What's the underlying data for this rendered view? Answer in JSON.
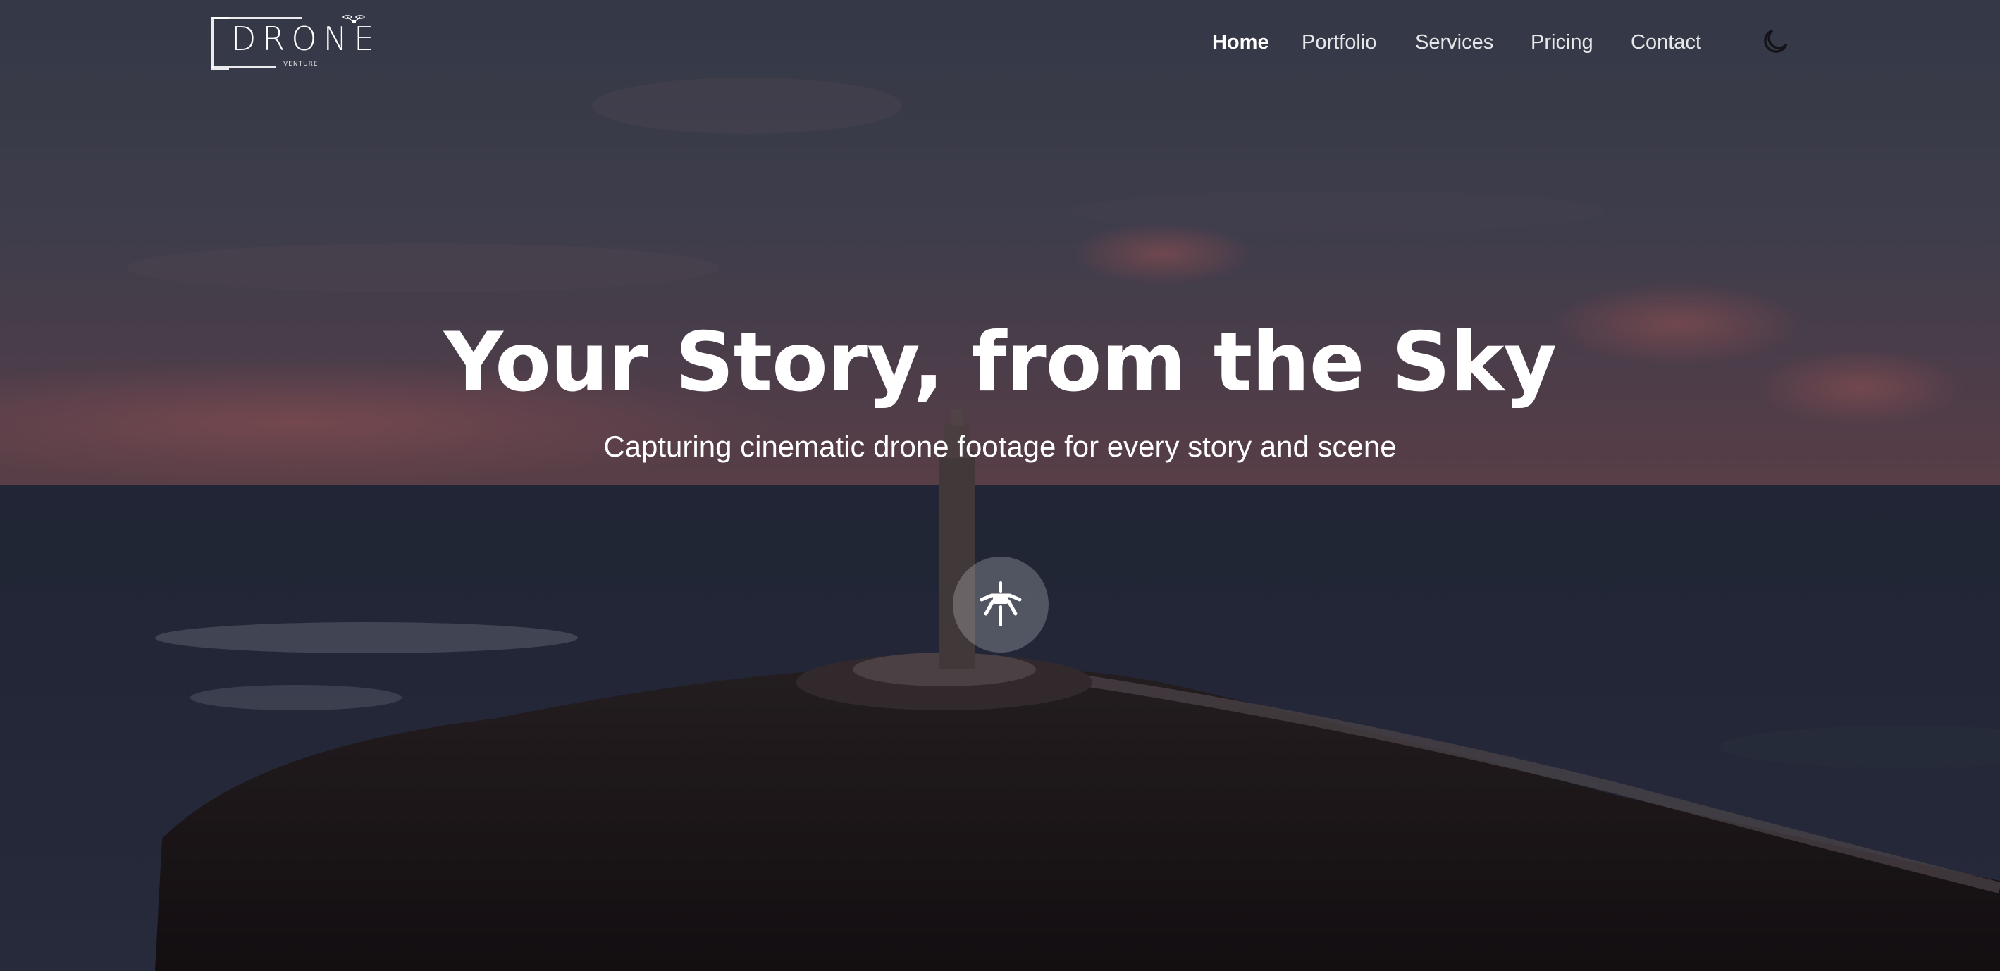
{
  "brand": {
    "name": "DRONE",
    "tagline": "VENTURE"
  },
  "nav": {
    "items": [
      {
        "label": "Home",
        "active": true
      },
      {
        "label": "Portfolio",
        "active": false
      },
      {
        "label": "Services",
        "active": false
      },
      {
        "label": "Pricing",
        "active": false
      },
      {
        "label": "Contact",
        "active": false
      }
    ],
    "theme_toggle_icon": "moon-icon"
  },
  "hero": {
    "title": "Your Story, from the Sky",
    "subtitle": "Capturing cinematic drone footage for every story and scene",
    "cta_icon": "drone-icon",
    "background": "aerial-lighthouse-coast"
  },
  "colors": {
    "sky_top": "#3b4152",
    "sky_bottom": "#6a4a55",
    "sea": "#1f2536",
    "land": "#1a1416",
    "text": "#ffffff"
  }
}
